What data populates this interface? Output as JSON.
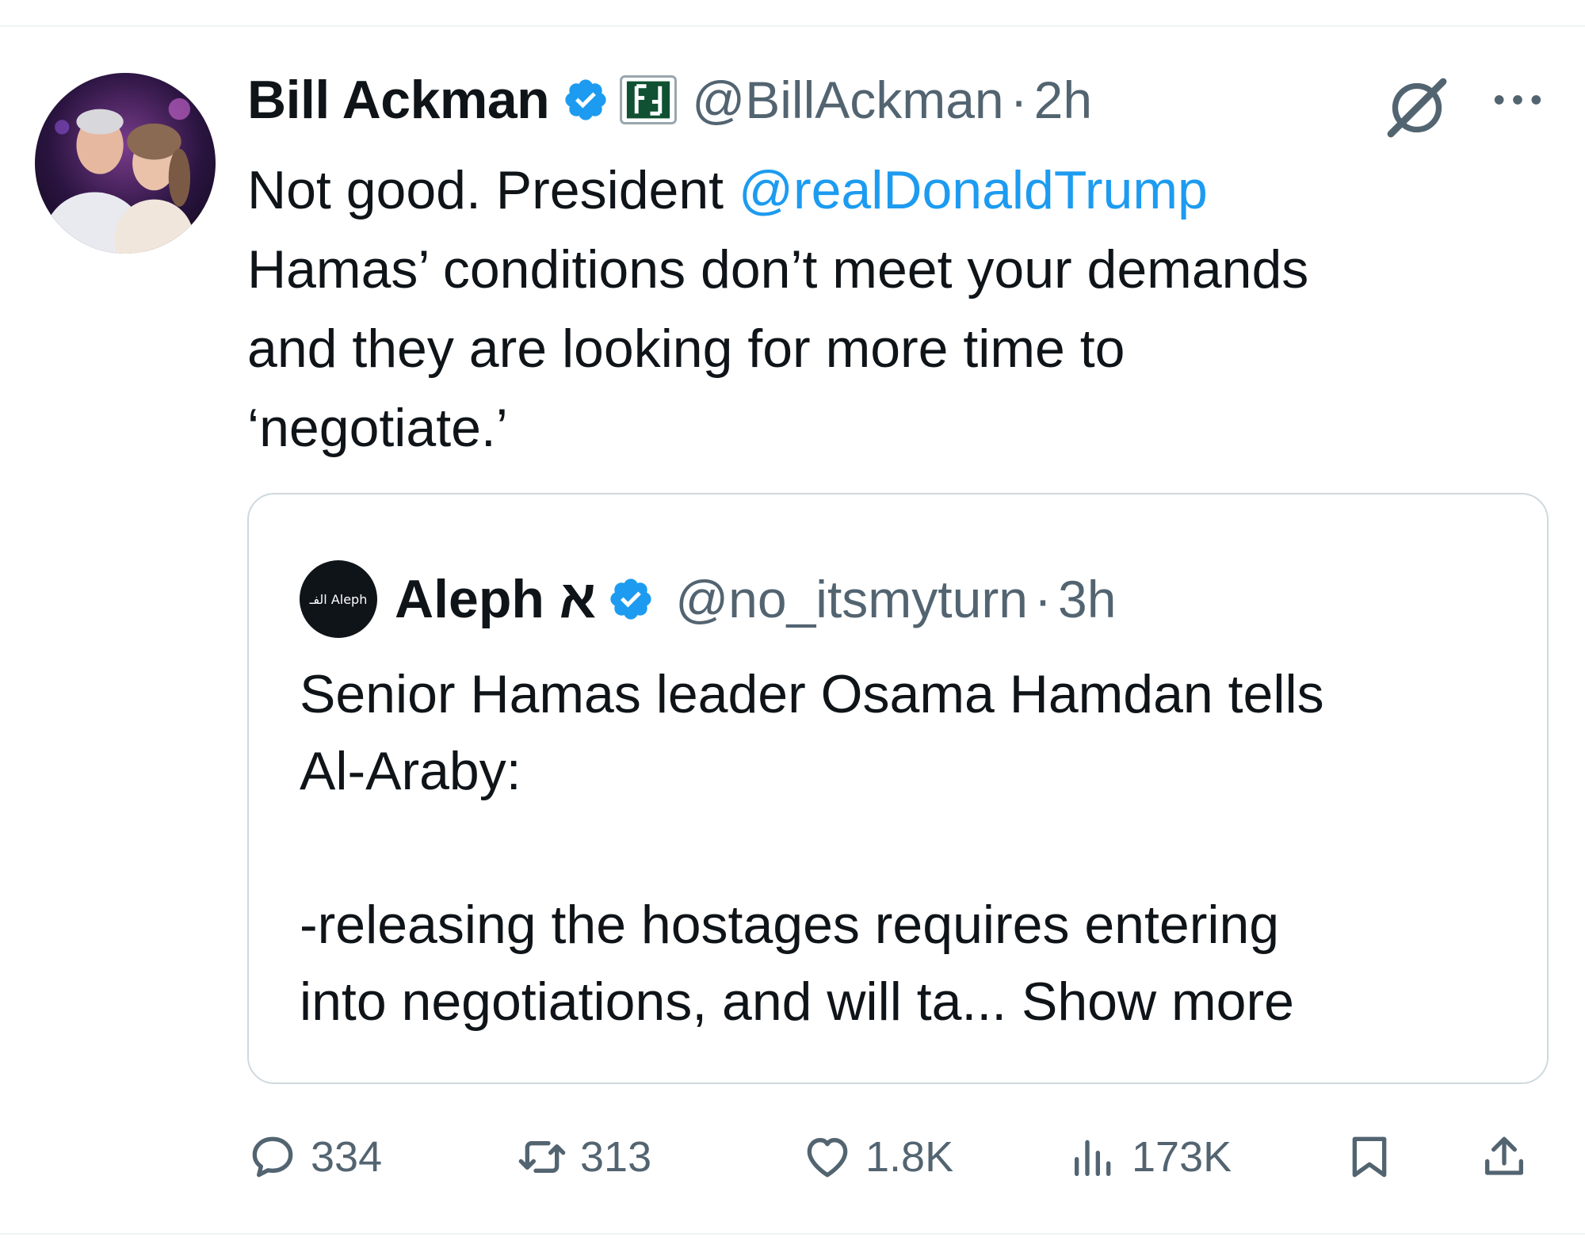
{
  "author": {
    "name": "Bill Ackman",
    "handle": "@BillAckman",
    "separator": "·",
    "time": "2h"
  },
  "tweet": {
    "prefix": "Not good. President ",
    "mention": "@realDonaldTrump",
    "suffix": "\nHamas’ conditions don’t meet your demands\nand they are looking for more time to\n‘negotiate.’"
  },
  "quote": {
    "name": "Aleph א",
    "handle": "@no_itsmyturn",
    "separator": "·",
    "time": "3h",
    "text": "Senior Hamas leader Osama Hamdan tells\nAl-Araby:\n\n-releasing the hostages requires entering\ninto negotiations, and will ta... Show more",
    "avatar_text": "الفـ Aleph"
  },
  "stats": {
    "replies": "334",
    "reposts": "313",
    "likes": "1.8K",
    "views": "173K"
  },
  "icons": {
    "verified": "verified-badge-icon",
    "affiliate": "affiliate-badge-icon",
    "grok": "grok-icon",
    "more": "more-icon",
    "reply": "reply-icon",
    "repost": "repost-icon",
    "like": "like-icon",
    "views": "views-icon",
    "bookmark": "bookmark-icon",
    "share": "share-icon"
  },
  "colors": {
    "accent": "#1d9bf0",
    "text": "#0f1419",
    "secondary": "#536471",
    "border": "#cfd9de",
    "affiliate_green": "#0f5132"
  }
}
